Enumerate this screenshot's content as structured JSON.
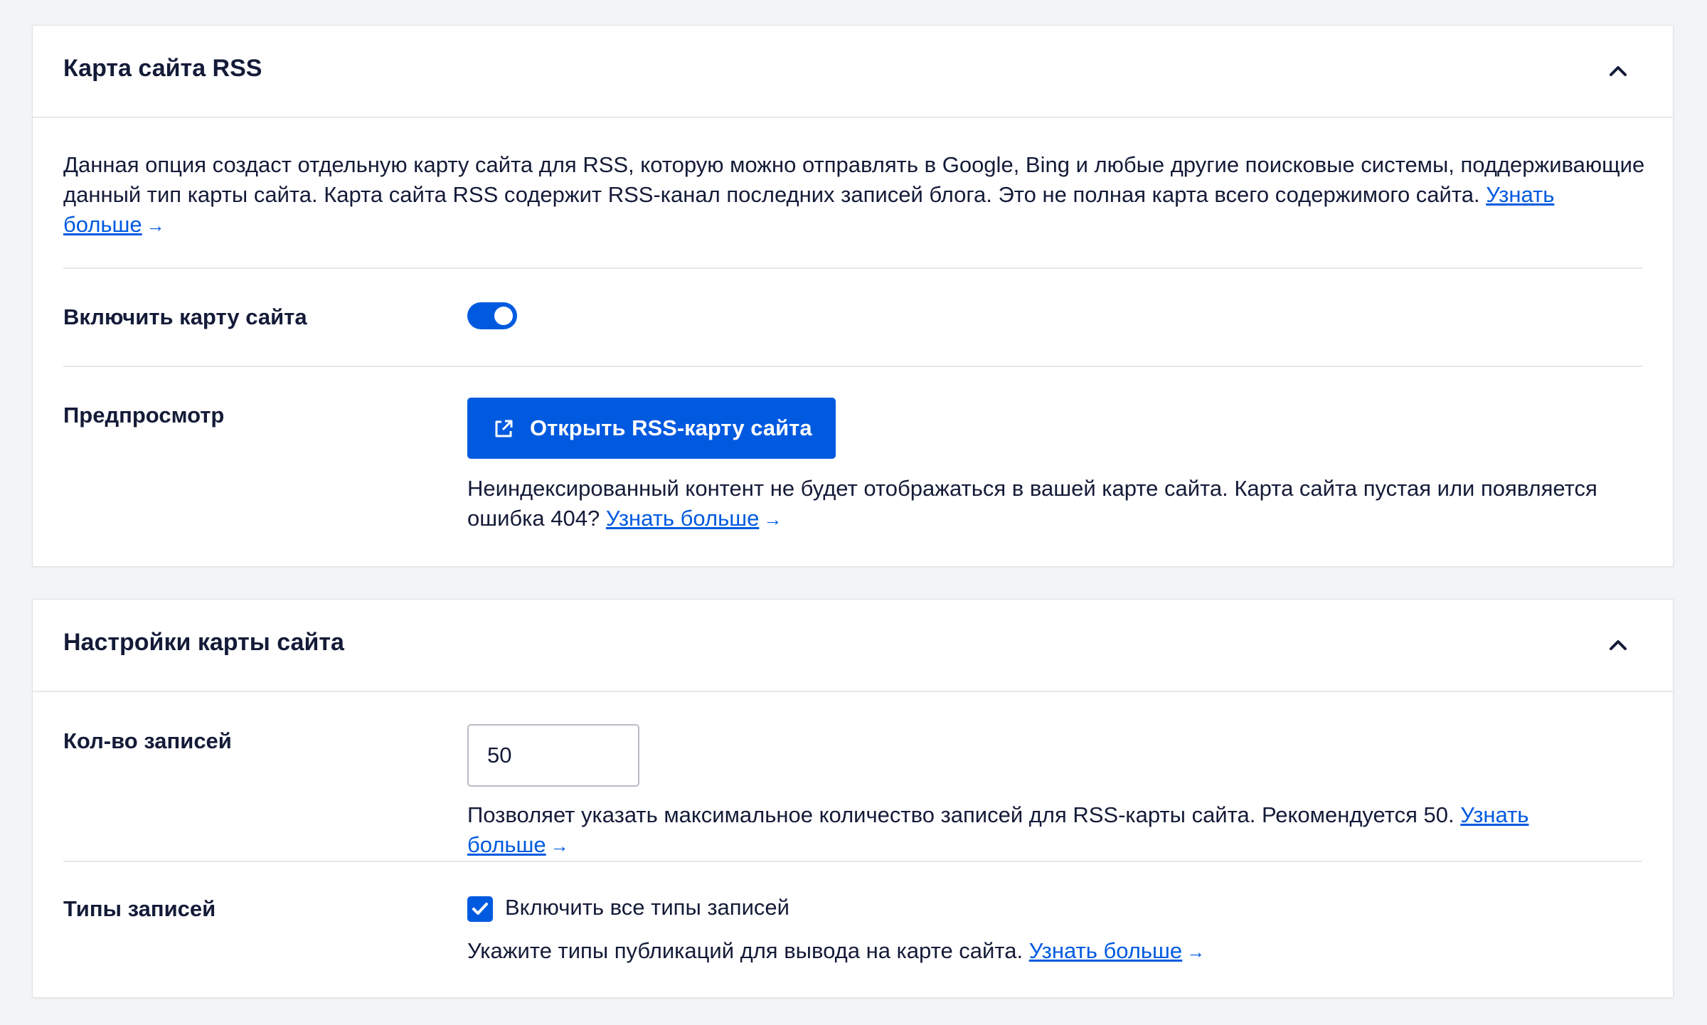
{
  "rss_section": {
    "title": "Карта сайта RSS",
    "description": "Данная опция создаст отдельную карту сайта для RSS, которую можно отправлять в Google, Bing и любые другие поисковые системы, поддерживающие данный тип карты сайта. Карта сайта RSS содержит RSS-канал последних записей блога. Это не полная карта всего содержимого сайта.",
    "description_link": "Узнать больше",
    "enable_label": "Включить карту сайта",
    "enable_value": true,
    "preview_label": "Предпросмотр",
    "open_button_label": "Открыть RSS-карту сайта",
    "preview_help": "Неиндексированный контент не будет отображаться в вашей карте сайта. Карта сайта пустая или появляется ошибка 404?",
    "preview_help_link": "Узнать больше"
  },
  "settings_section": {
    "title": "Настройки карты сайта",
    "post_count_label": "Кол-во записей",
    "post_count_value": "50",
    "post_count_help": "Позволяет указать максимальное количество записей для RSS-карты сайта. Рекомендуется 50.",
    "post_count_help_link": "Узнать больше",
    "post_types_label": "Типы записей",
    "include_all_label": "Включить все типы записей",
    "include_all_checked": true,
    "post_types_help": "Укажите типы публикаций для вывода на карте сайта.",
    "post_types_help_link": "Узнать больше"
  },
  "arrow_glyph": "→",
  "colors": {
    "accent": "#005ae0",
    "text": "#141b38",
    "background": "#f3f4f5"
  },
  "icons": {
    "collapse": "chevron-up-icon",
    "external": "external-link-icon",
    "check": "check-icon"
  }
}
